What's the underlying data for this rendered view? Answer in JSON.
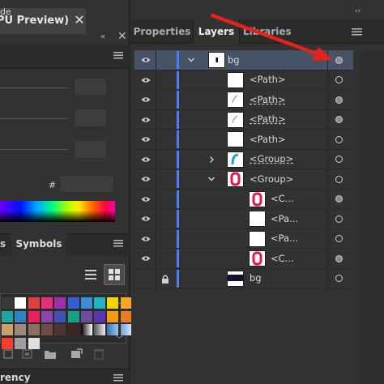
{
  "document": {
    "tab_title": "PU Preview)",
    "close": "✕"
  },
  "left_panel": {
    "collapse_glyph": "«",
    "close_glyph": "✕",
    "color_guide_label": "de",
    "hex_sign": "#",
    "hex_value": ""
  },
  "swatches_panel": {
    "tab_left": "s",
    "tab_symbols": "Symbols",
    "colors": [
      [
        "#3a3a3a",
        "#ffffff",
        "#e73c3c",
        "#e62f7a",
        "#9b2fae",
        "#2f5fd9",
        "#3a8ddb",
        "#1fb5c2",
        "#f5d400",
        "#f5a623"
      ],
      [
        "#1fa3a3",
        "#2e86c1",
        "#e91e63",
        "#8e44ad",
        "#3f51b5",
        "#16a085",
        "#6d4c9f",
        "#5e35b1",
        "#f39c12",
        "#e67e22"
      ],
      [
        "#c9a26b",
        "#a1887f",
        "#8d6e63",
        "#6d4c41",
        "#4e342e",
        "#3e2723",
        "#a0a0a0",
        "#c0c0c0",
        "#8fb8de",
        "#b5d3f0"
      ],
      [
        "#ff3b30",
        "#9e9e9e",
        "#e0e0e0"
      ]
    ]
  },
  "transparency_panel": {
    "label": "rency"
  },
  "layers_panel": {
    "tabs": [
      {
        "label": "Properties"
      },
      {
        "label": "Layers"
      },
      {
        "label": "Libraries"
      }
    ],
    "top_collapse": "››",
    "rows": [
      {
        "name": "bg",
        "expanded": true,
        "selected": true,
        "thumb": "bg-dot"
      },
      {
        "name": "<Path>",
        "thumb": "blank"
      },
      {
        "name": "<Path>",
        "thumb": "curve",
        "underline": true
      },
      {
        "name": "<Path>",
        "thumb": "curve",
        "underline": true
      },
      {
        "name": "<Path>",
        "thumb": "blank"
      },
      {
        "name": "<Group>",
        "thumb": "group-blue",
        "underline": true
      },
      {
        "name": "<Group>",
        "thumb": "group-pink",
        "expanded": true
      },
      {
        "name": "<C...",
        "thumb": "pink"
      },
      {
        "name": "<Pa...",
        "thumb": "blank"
      },
      {
        "name": "<Pa...",
        "thumb": "blank"
      },
      {
        "name": "<C...",
        "thumb": "pink"
      },
      {
        "name": "bg",
        "thumb": "bg-dark",
        "locked": true
      }
    ]
  },
  "colors": {
    "panel_bg": "#323232",
    "selection": "#465266",
    "layer_color_stripe": "#4d7cf7",
    "annotation_arrow": "#e4231b"
  }
}
